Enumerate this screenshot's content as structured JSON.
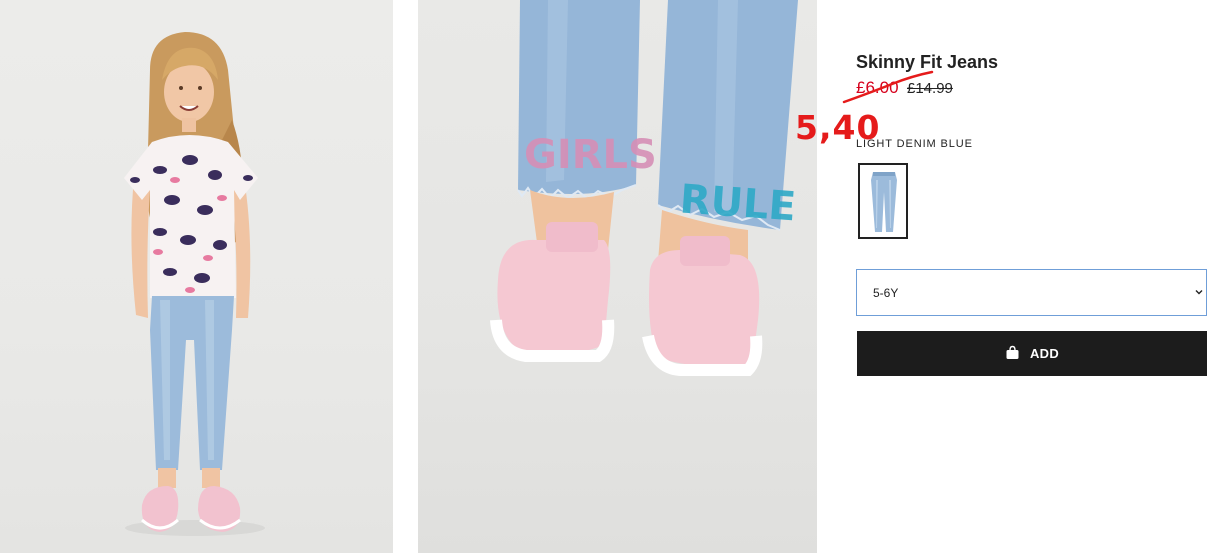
{
  "product": {
    "title": "Skinny Fit Jeans",
    "sale_price": "£6.00",
    "original_price": "£14.99",
    "annotated_price": "5,40",
    "color_name": "LIGHT DENIM BLUE",
    "selected_size": "5-6Y",
    "add_label": "ADD"
  },
  "images": {
    "model_photo": "girl-in-leopard-tee-and-skinny-jeans",
    "detail_photo": "jeans-hem-GIRLS-RULE-glitter-pink-slip-ons",
    "hem_text_left": "GIRLS",
    "hem_text_right": "RULE"
  },
  "icons": {
    "bag": "shopping-bag-icon",
    "chevron": "chevron-down-icon"
  },
  "colors": {
    "sale": "#d6001c",
    "annotation": "#e51b1b",
    "button_bg": "#1c1c1c",
    "select_border": "#6f9ed8",
    "denim": "#9cbbdb"
  }
}
